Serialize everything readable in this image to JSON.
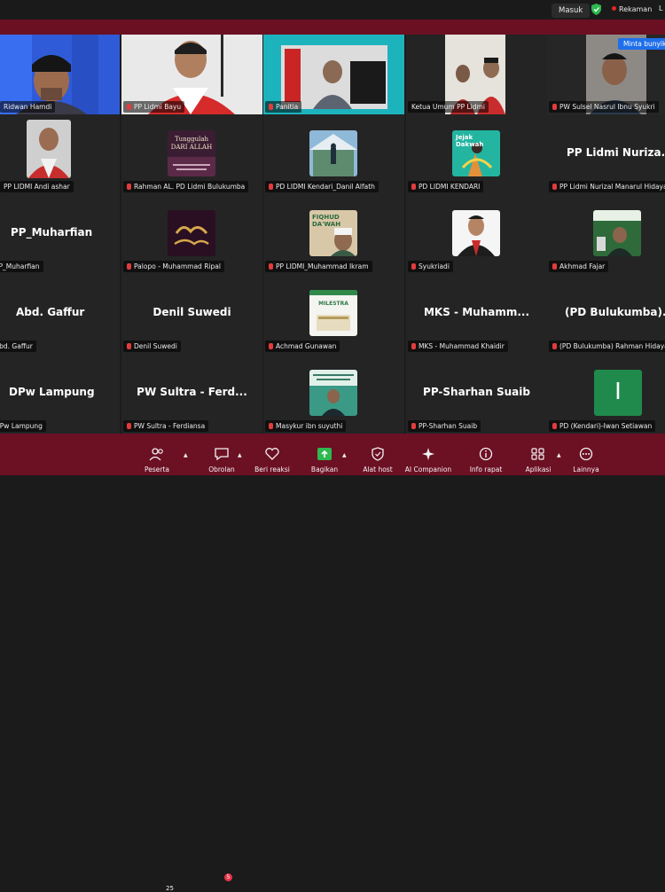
{
  "topbar": {
    "signin_label": "Masuk",
    "recording_label": "Rekaman",
    "trailing": "L"
  },
  "tooltip": "Minta bunyikan",
  "tiles": [
    {
      "label": "Ridwan Hamdi"
    },
    {
      "label": "PP Lidmi Bayu"
    },
    {
      "label": "Panitia"
    },
    {
      "label": "Ketua Umum PP Lidmi"
    },
    {
      "label": "PW Sulsel Nasrul Ibnu Syukri"
    },
    {
      "label": "PP LIDMI Andi ashar"
    },
    {
      "label": "Rahman AL. PD Lidmi Bulukumba",
      "poster_text": "Tunggulah DARI ALLAH"
    },
    {
      "label": "PD LIDMI Kendari_Danil Alfath"
    },
    {
      "label": "PD LIDMI KENDARI",
      "poster_text": "Jejak Dakwah"
    },
    {
      "label": "PP Lidmi Nurizal Manarul Hidayat",
      "big": "PP Lidmi Nuriza..."
    },
    {
      "label": "PP_Muharfian",
      "big": "PP_Muharfian"
    },
    {
      "label": "Palopo - Muhammad Ripal"
    },
    {
      "label": "PP LIDMI_Muhammad Ikram",
      "poster_text": "FIQHUD DA'WAH"
    },
    {
      "label": "Syukriadi"
    },
    {
      "label": "Akhmad Fajar"
    },
    {
      "label": "Abd. Gaffur",
      "big": "Abd. Gaffur"
    },
    {
      "label": "Denil Suwedi",
      "big": "Denil Suwedi"
    },
    {
      "label": "Achmad Gunawan",
      "poster_text": "MILESTRA"
    },
    {
      "label": "MKS - Muhammad Khaidir",
      "big": "MKS - Muhamm..."
    },
    {
      "label": "(PD Bulukumba) Rahman Hidayat",
      "big": "(PD Bulukumba)..."
    },
    {
      "label": "DPw Lampung",
      "big": "DPw Lampung"
    },
    {
      "label": "PW Sultra - Ferdiansa",
      "big": "PW Sultra - Ferd..."
    },
    {
      "label": "Masykur ibn suyuthi"
    },
    {
      "label": "PP-Sharhan Suaib",
      "big": "PP-Sharhan Suaib"
    },
    {
      "label": "PD (Kendari)-Iwan Setiawan",
      "initial": "I"
    }
  ],
  "toolbar": {
    "participants": {
      "label": "Peserta",
      "count": "25"
    },
    "chat": {
      "label": "Obrolan",
      "badge": "5"
    },
    "react": {
      "label": "Beri reaksi"
    },
    "share": {
      "label": "Bagikan"
    },
    "host": {
      "label": "Alat host"
    },
    "ai": {
      "label": "AI Companion"
    },
    "info": {
      "label": "Info rapat"
    },
    "apps": {
      "label": "Aplikasi"
    },
    "more": {
      "label": "Lainnya"
    }
  },
  "colors": {
    "toolbar": "#6c1024",
    "highlight": "#39c55a",
    "share": "#2fb84f",
    "initial_tile": "#1f8a4c"
  }
}
